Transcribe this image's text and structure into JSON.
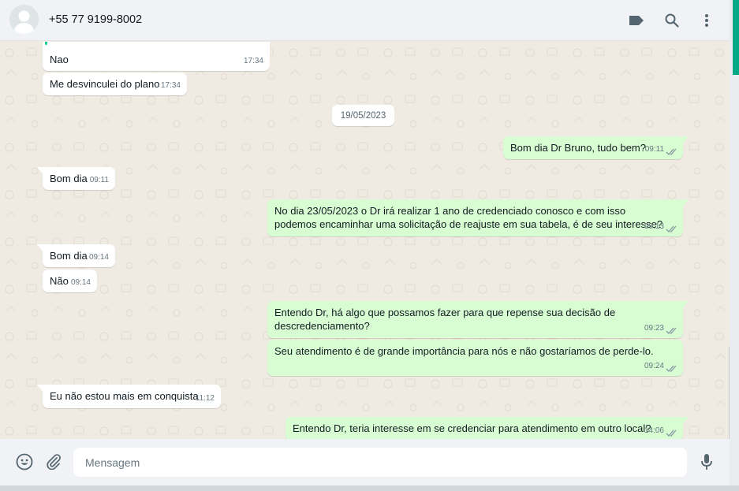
{
  "header": {
    "contact_name": "+55 77 9199-8002",
    "icons": [
      "label-icon",
      "search-icon",
      "menu-icon"
    ]
  },
  "chat": {
    "date_separator": "19/05/2023",
    "messages": [
      {
        "direction": "in",
        "text": "Nao",
        "time": "17:34"
      },
      {
        "direction": "in",
        "text": "Me desvinculei do plano",
        "time": "17:34"
      },
      {
        "direction": "out",
        "text": "Bom dia Dr Bruno, tudo bem?",
        "time": "09:11",
        "status": "read"
      },
      {
        "direction": "in",
        "text": "Bom dia",
        "time": "09:11"
      },
      {
        "direction": "out",
        "text": "No dia 23/05/2023 o Dr irá realizar 1 ano de credenciado conosco e com isso podemos encaminhar uma solicitação de reajuste em sua tabela, é de seu interesse?",
        "time": "09:13",
        "status": "read"
      },
      {
        "direction": "in",
        "text": "Bom dia",
        "time": "09:14"
      },
      {
        "direction": "in",
        "text": "Não",
        "time": "09:14"
      },
      {
        "direction": "out",
        "text": "Entendo Dr, há algo que possamos fazer para que repense sua decisão de descredenciamento?",
        "time": "09:23",
        "status": "read"
      },
      {
        "direction": "out",
        "text": "Seu atendimento é de grande importância para nós e não gostaríamos de perde-lo.",
        "time": "09:24",
        "status": "read"
      },
      {
        "direction": "in",
        "text": "Eu não estou mais em conquista",
        "time": "11:12"
      },
      {
        "direction": "out",
        "text": "Entendo Dr, teria interesse em se credenciar para atendimento em outro local?",
        "time": "14:06",
        "status": "read"
      }
    ]
  },
  "footer": {
    "placeholder": "Mensagem",
    "icons": [
      "emoji-icon",
      "attach-icon",
      "microphone-icon"
    ]
  },
  "colors": {
    "incoming_bubble": "#ffffff",
    "outgoing_bubble": "#d9fdd3",
    "chat_background": "#efeae2",
    "read_ticks": "#8696a0",
    "accent": "#00a884"
  }
}
